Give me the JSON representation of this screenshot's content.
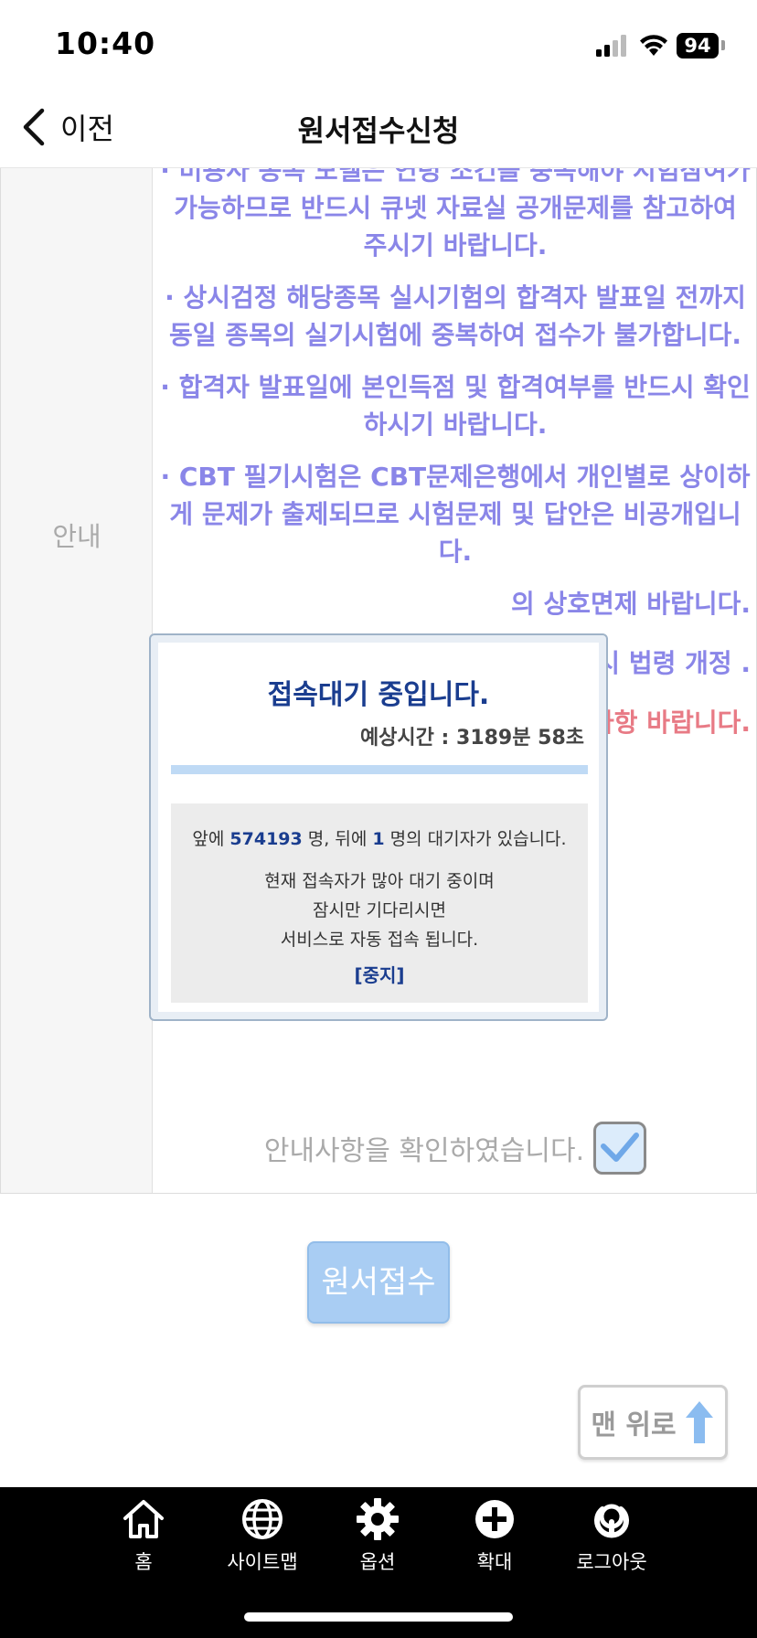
{
  "status_bar": {
    "time": "10:40",
    "battery": "94"
  },
  "header": {
    "back_label": "이전",
    "title": "원서접수신청"
  },
  "section_label": "안내",
  "notices": [
    {
      "text": "· 미용사 종목 모델은 연령 조건을 충족해야 시험참여가 가능하므로 반드시 큐넷 자료실 공개문제를 참고하여 주시기 바랍니다.",
      "color": "#8a86e8"
    },
    {
      "text": "· 상시검정 해당종목 실시기험의 합격자 발표일 전까지 동일 종목의 실기시험에 중복하여 접수가 불가합니다.",
      "color": "#8a86e8"
    },
    {
      "text": "· 합격자 발표일에 본인득점 및 합격여부를 반드시 확인하시기 바랍니다.",
      "color": "#8a86e8"
    },
    {
      "text": "· CBT 필기시험은 CBT문제은행에서 개인별로 상이하게 문제가 출제되므로 시험문제 및 답안은 비공개입니다.",
      "color": "#8a86e8"
    },
    {
      "text": "의 상호면제 바랍니다.",
      "color": "#8a86e8"
    },
    {
      "text": "목의 과목면 시 법령 개정 .",
      "color": "#8a86e8"
    },
    {
      "text": "자 유의사항 바랍니다.",
      "color": "#e87a85"
    }
  ],
  "confirm_text": "안내사항을 확인하였습니다.",
  "submit_label": "원서접수",
  "top_button_label": "맨 위로",
  "modal": {
    "title": "접속대기 중입니다.",
    "estimate": "예상시간 : 3189분 58초",
    "progress": 0,
    "wait_prefix": "앞에",
    "ahead_count": "574193",
    "wait_mid": "명, 뒤에",
    "behind_count": "1",
    "wait_suffix": "명의 대기자가 있습니다.",
    "msg1": "현재 접속자가 많아 대기 중이며",
    "msg2": "잠시만 기다리시면",
    "msg3": "서비스로 자동 접속 됩니다.",
    "stop_label": "[중지]"
  },
  "bottom_nav": [
    {
      "label": "홈",
      "icon": "home-icon"
    },
    {
      "label": "사이트맵",
      "icon": "globe-icon"
    },
    {
      "label": "옵션",
      "icon": "gear-icon"
    },
    {
      "label": "확대",
      "icon": "plus-circle-icon"
    },
    {
      "label": "로그아웃",
      "icon": "logout-icon"
    }
  ],
  "colors": {
    "notice_blue": "#8a86e8",
    "notice_red": "#e87a85",
    "modal_accent": "#1a3d8f",
    "submit_bg": "#a9cdf3"
  }
}
